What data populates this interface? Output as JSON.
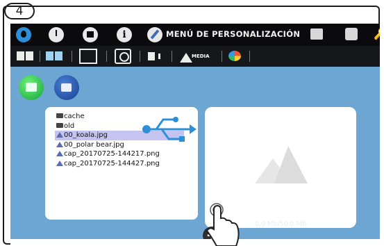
{
  "step": {
    "number": "4"
  },
  "topbar": {
    "title": "MENÚ DE PERSONALIZACIÓN",
    "icons": [
      "water-drop-icon",
      "clock-icon",
      "screen-icon",
      "info-icon",
      "pencil-icon",
      "keyboard-icon",
      "person-icon",
      "key-icon"
    ]
  },
  "toolbar": {
    "media_label": "MEDIA",
    "active_tab": "media"
  },
  "media_type_buttons": [
    "image-icon",
    "video-camera-icon"
  ],
  "files": [
    {
      "name": "cache",
      "kind": "folder"
    },
    {
      "name": "old",
      "kind": "folder"
    },
    {
      "name": "00_koala.jpg",
      "kind": "image",
      "selected": true
    },
    {
      "name": "00_polar bear.jpg",
      "kind": "image"
    },
    {
      "name": "cap_20170725-144217.png",
      "kind": "image"
    },
    {
      "name": "cap_20170725-144427.png",
      "kind": "image"
    }
  ],
  "storage": {
    "label": "0.0 Mb/50.0 MB"
  },
  "colors": {
    "topbar_bg": "#0b0b0d",
    "content_bg": "#6ea6d3",
    "selection_highlight": "#c5c4f0",
    "usb_icon": "#2f8fd6"
  }
}
